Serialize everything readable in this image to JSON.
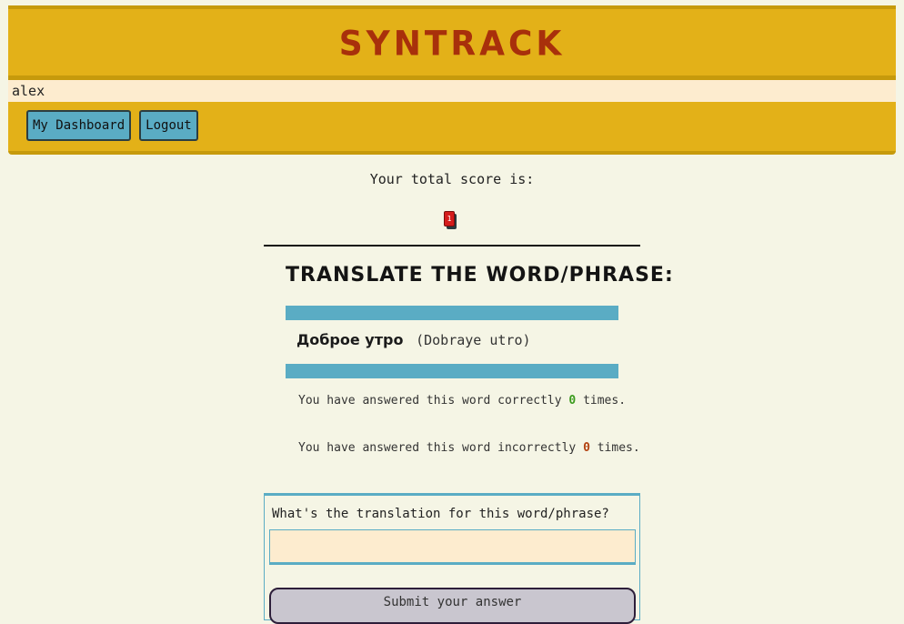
{
  "app": {
    "title": "SYNTRACK",
    "username": "alex"
  },
  "nav": {
    "dashboard_label": "My Dashboard",
    "logout_label": "Logout"
  },
  "score": {
    "label": "Your total score is:",
    "value": "1"
  },
  "quiz": {
    "heading": "Translate the word/phrase:",
    "word": "Доброе утро",
    "transliteration": "(Dobraye utro)",
    "correct_prefix": "You have answered this word correctly",
    "correct_count": "0",
    "correct_suffix": "times.",
    "incorrect_prefix": "You have answered this word incorrectly",
    "incorrect_count": "0",
    "incorrect_suffix": "times."
  },
  "answer": {
    "label": "What's the translation for this word/phrase?",
    "value": "",
    "submit_label": "Submit your answer"
  },
  "colors": {
    "header_bg": "#e3b118",
    "title_color": "#a8300b",
    "accent_blue": "#5aacc4",
    "page_bg": "#f5f5e5",
    "input_bg": "#fdeccf"
  }
}
